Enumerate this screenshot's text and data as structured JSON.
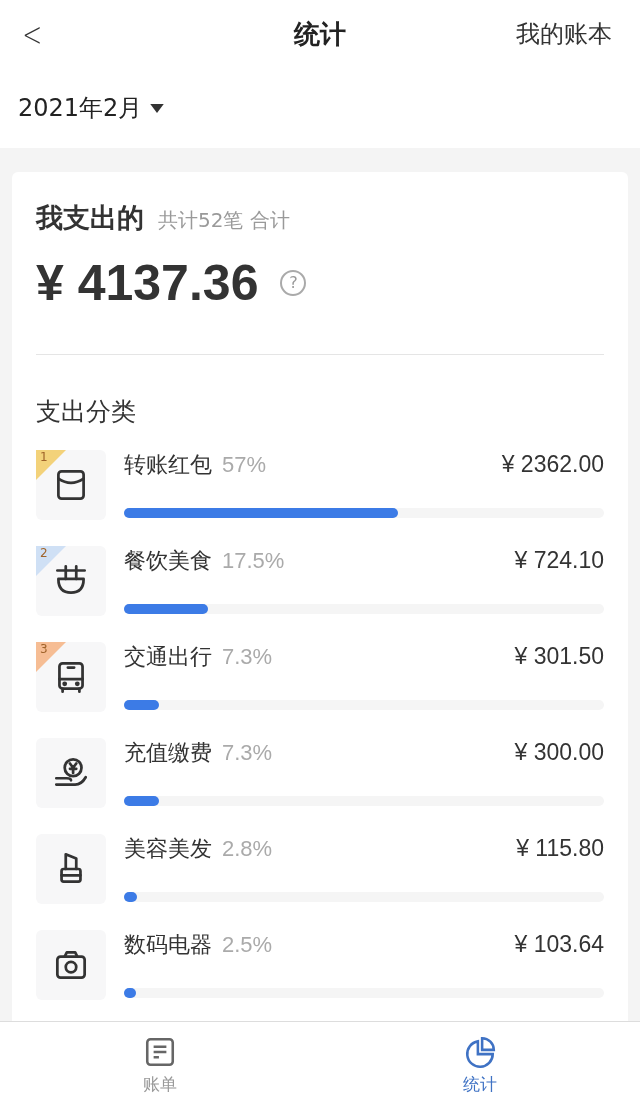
{
  "header": {
    "back": "<",
    "title": "统计",
    "action": "我的账本"
  },
  "month": "2021年2月",
  "summary": {
    "title": "我支出的",
    "count": "共计52笔 合计",
    "amount": "¥ 4137.36",
    "help": "?"
  },
  "section_title": "支出分类",
  "categories": [
    {
      "kind": "envelope",
      "rank": "1",
      "color": "#f3d27a",
      "name": "转账红包",
      "percent": "57%",
      "amount": "¥ 2362.00",
      "level": 0.57
    },
    {
      "kind": "bowl",
      "rank": "2",
      "color": "#cfe0f5",
      "name": "餐饮美食",
      "percent": "17.5%",
      "amount": "¥ 724.10",
      "level": 0.175
    },
    {
      "kind": "bus",
      "rank": "3",
      "color": "#f6bd94",
      "name": "交通出行",
      "percent": "7.3%",
      "amount": "¥ 301.50",
      "level": 0.073
    },
    {
      "kind": "coin",
      "name": "充值缴费",
      "percent": "7.3%",
      "amount": "¥ 300.00",
      "level": 0.073
    },
    {
      "kind": "lipstick",
      "name": "美容美发",
      "percent": "2.8%",
      "amount": "¥ 115.80",
      "level": 0.028
    },
    {
      "kind": "camera",
      "name": "数码电器",
      "percent": "2.5%",
      "amount": "¥ 103.64",
      "level": 0.025
    }
  ],
  "tabs": [
    {
      "kind": "bill",
      "label": "账单",
      "selected": false
    },
    {
      "kind": "stats",
      "label": "统计",
      "selected": true
    }
  ]
}
